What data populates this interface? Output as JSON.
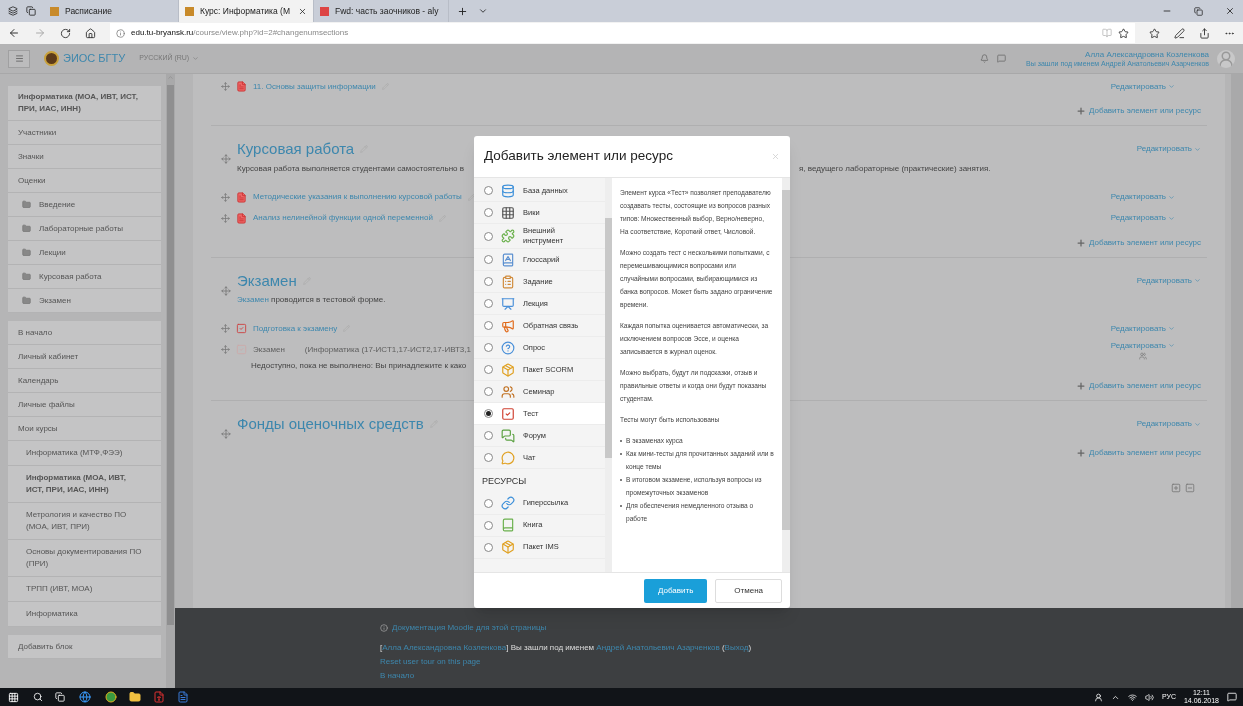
{
  "browser": {
    "tabs": [
      {
        "label": "Расписание",
        "selected": false
      },
      {
        "label": "Курс: Информатика (М",
        "selected": true
      },
      {
        "label": "Fwd: часть заочников - aly",
        "selected": false
      }
    ],
    "url_host": "edu.tu-bryansk.ru",
    "url_path": "/course/view.php?id=2#changenumsections"
  },
  "navbar": {
    "site_name": "ЭИОС БГТУ",
    "language": "РУССКИЙ (RU)",
    "user_name": "Алла Александровна Козленкова",
    "login_as": "Вы зашли под именем Андрей Анатольевич Азарченков"
  },
  "sidebar": {
    "groups": [
      {
        "items": [
          {
            "label": "Информатика (МОА, ИВТ, ИСТ, ПРИ, ИАС, ИНН)",
            "kind": "heading"
          },
          {
            "label": "Участники",
            "kind": "link"
          },
          {
            "label": "Значки",
            "kind": "link"
          },
          {
            "label": "Оценки",
            "kind": "link"
          },
          {
            "label": "Введение",
            "kind": "folder"
          },
          {
            "label": "Лабораторные работы",
            "kind": "folder"
          },
          {
            "label": "Лекции",
            "kind": "folder"
          },
          {
            "label": "Курсовая работа",
            "kind": "folder"
          },
          {
            "label": "Экзамен",
            "kind": "folder"
          }
        ]
      },
      {
        "items": [
          {
            "label": "В начало",
            "kind": "link"
          },
          {
            "label": "Личный кабинет",
            "kind": "link"
          },
          {
            "label": "Календарь",
            "kind": "link"
          },
          {
            "label": "Личные файлы",
            "kind": "link"
          },
          {
            "label": "Мои курсы",
            "kind": "link",
            "children": [
              {
                "label": "Информатика (МТФ,ФЭЭ)",
                "selected": false
              },
              {
                "label": "Информатика (МОА, ИВТ, ИСТ, ПРИ, ИАС, ИНН)",
                "selected": true
              },
              {
                "label": "Метрология и качество ПО (МОА, ИВТ, ПРИ)",
                "selected": false
              },
              {
                "label": "Основы документирования ПО (ПРИ)",
                "selected": false
              },
              {
                "label": "ТРПП (ИВТ, МОА)",
                "selected": false
              },
              {
                "label": "Информатика",
                "selected": false
              }
            ]
          }
        ]
      },
      {
        "items": [
          {
            "label": "Добавить блок",
            "kind": "link"
          }
        ]
      }
    ]
  },
  "course": {
    "sections": [
      {
        "activities": [
          {
            "label": "11. Основы защиты информации",
            "kind": "file",
            "available": true,
            "edit": "Редактировать"
          }
        ],
        "add": "Добавить элемент или ресурс"
      },
      {
        "title": "Курсовая работа",
        "edit": "Редактировать",
        "summary_parts": [
          "Курсовая работа выполняется студентами самостоятельно в",
          "я, ведущего лабораторные (практические) занятия."
        ],
        "activities": [
          {
            "label": "Методические указания к выполнению курсовой работы",
            "kind": "file",
            "available": true,
            "edit": "Редактировать"
          },
          {
            "label": "Анализ нелинейной функции одной переменной",
            "kind": "file",
            "available": true,
            "edit": "Редактировать"
          }
        ],
        "add": "Добавить элемент или ресурс"
      },
      {
        "title": "Экзамен",
        "edit": "Редактировать",
        "summary_link": "Экзамен",
        "summary_text": "проводится в тестовой форме.",
        "activities": [
          {
            "label": "Подготовка к экзамену",
            "kind": "quiz",
            "available": true,
            "edit": "Редактировать"
          },
          {
            "label": "Экзамен",
            "kind": "quiz",
            "available": false,
            "restriction": "(Информатика (17-ИСТ1,17-ИСТ2,17-ИВТ3,1",
            "note": "Недоступно, пока не выполнено: Вы принадлежите к како",
            "edit": "Редактировать"
          }
        ],
        "add": "Добавить элемент или ресурс"
      },
      {
        "title": "Фонды оценочных средств",
        "edit": "Редактировать",
        "add": "Добавить элемент или ресурс"
      }
    ]
  },
  "modal": {
    "title": "Добавить элемент или ресурс",
    "modules": [
      {
        "label": "База данных",
        "selected": false
      },
      {
        "label": "Вики",
        "selected": false
      },
      {
        "label": "Внешний инструмент",
        "selected": false
      },
      {
        "label": "Глоссарий",
        "selected": false
      },
      {
        "label": "Задание",
        "selected": false
      },
      {
        "label": "Лекция",
        "selected": false
      },
      {
        "label": "Обратная связь",
        "selected": false
      },
      {
        "label": "Опрос",
        "selected": false
      },
      {
        "label": "Пакет SCORM",
        "selected": false
      },
      {
        "label": "Семинар",
        "selected": false
      },
      {
        "label": "Тест",
        "selected": true
      },
      {
        "label": "Форум",
        "selected": false
      },
      {
        "label": "Чат",
        "selected": false
      }
    ],
    "resources_heading": "РЕСУРСЫ",
    "resources": [
      {
        "label": "Гиперссылка",
        "selected": false
      },
      {
        "label": "Книга",
        "selected": false
      },
      {
        "label": "Пакет IMS",
        "selected": false
      }
    ],
    "description": [
      "Элемент курса «Тест» позволяет преподавателю создавать тесты, состоящие из вопросов разных типов: Множественный выбор, Верно/неверно, На соответствие, Короткий ответ, Числовой.",
      "Можно создать тест с несколькими попытками, с перемешивающимися вопросами или случайными вопросами, выбирающимися из банка вопросов. Может быть задано ограничение времени.",
      "Каждая попытка оценивается автоматически, за исключением вопросов Эссе, и оценка записывается в журнал оценок.",
      "Можно выбрать, будут ли подсказки, отзыв и правильные ответы и когда они будут показаны студентам.",
      "Тесты могут быть использованы"
    ],
    "uses": [
      "В экзаменах курса",
      "Как мини-тесты для прочитанных заданий или в конце темы",
      "В итоговом экзамене, используя вопросы из промежуточных экзаменов",
      "Для обеспечения немедленного отзыва о работе"
    ],
    "add_button": "Добавить",
    "cancel_button": "Отмена"
  },
  "footer": {
    "docs_link": "Документация Moodle для этой страницы",
    "login_parts": [
      {
        "text": "[",
        "kind": "plain"
      },
      {
        "text": "Алла Александровна Козленкова",
        "kind": "link"
      },
      {
        "text": "] Вы зашли под именем ",
        "kind": "plain"
      },
      {
        "text": "Андрей Анатольевич Азарченков",
        "kind": "link"
      },
      {
        "text": " (",
        "kind": "plain"
      },
      {
        "text": "Выход",
        "kind": "link"
      },
      {
        "text": ")",
        "kind": "plain"
      }
    ],
    "reset_tour": "Reset user tour on this page",
    "home": "В начало"
  },
  "taskbar": {
    "language": "РУС",
    "time": "12:11",
    "date": "14.06.2018"
  }
}
